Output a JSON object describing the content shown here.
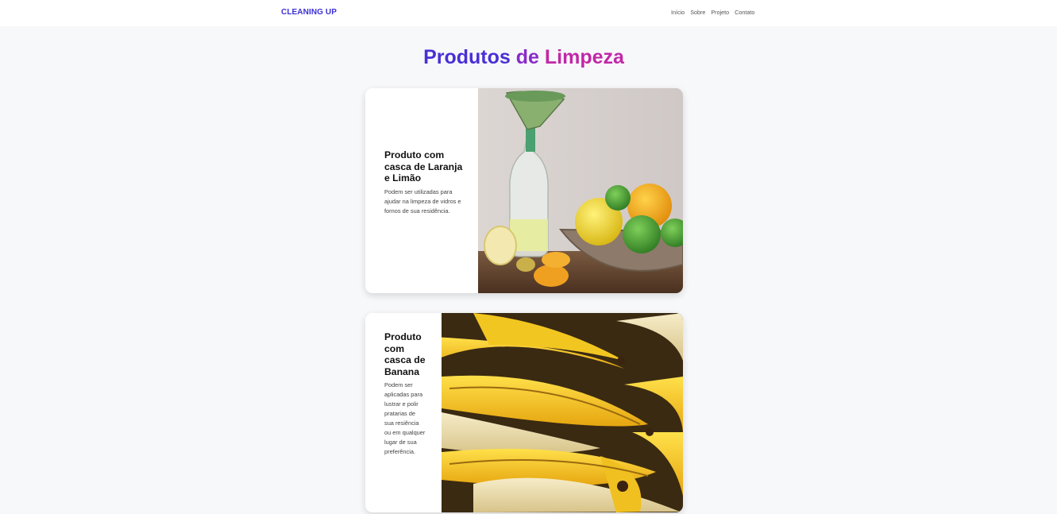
{
  "navbar": {
    "brand": "CLEANING UP",
    "links": [
      "Início",
      "Sobre",
      "Projeto",
      "Contato"
    ]
  },
  "main": {
    "title_part1": "Produtos",
    "title_part2": "de",
    "title_part3": "Limpeza"
  },
  "products": [
    {
      "title": "Produto com casca de Laranja e Limão",
      "description": "Podem ser utilizadas para ajudar na limpeza de vidros e fornos de sua residência.",
      "image": "citrus-peels-bottle-photo"
    },
    {
      "title": "Produto com casca de Banana",
      "description": "Podem ser aplicadas para lustrar e polir pratarias de sua resiência ou em qualquer lugar de sua preferência.",
      "image": "banana-peels-photo"
    }
  ],
  "colors": {
    "brand": "#3b30d6",
    "title_gradient_start": "#4a2fd6",
    "title_gradient_end": "#c128a6",
    "background": "#f7f8fa"
  }
}
